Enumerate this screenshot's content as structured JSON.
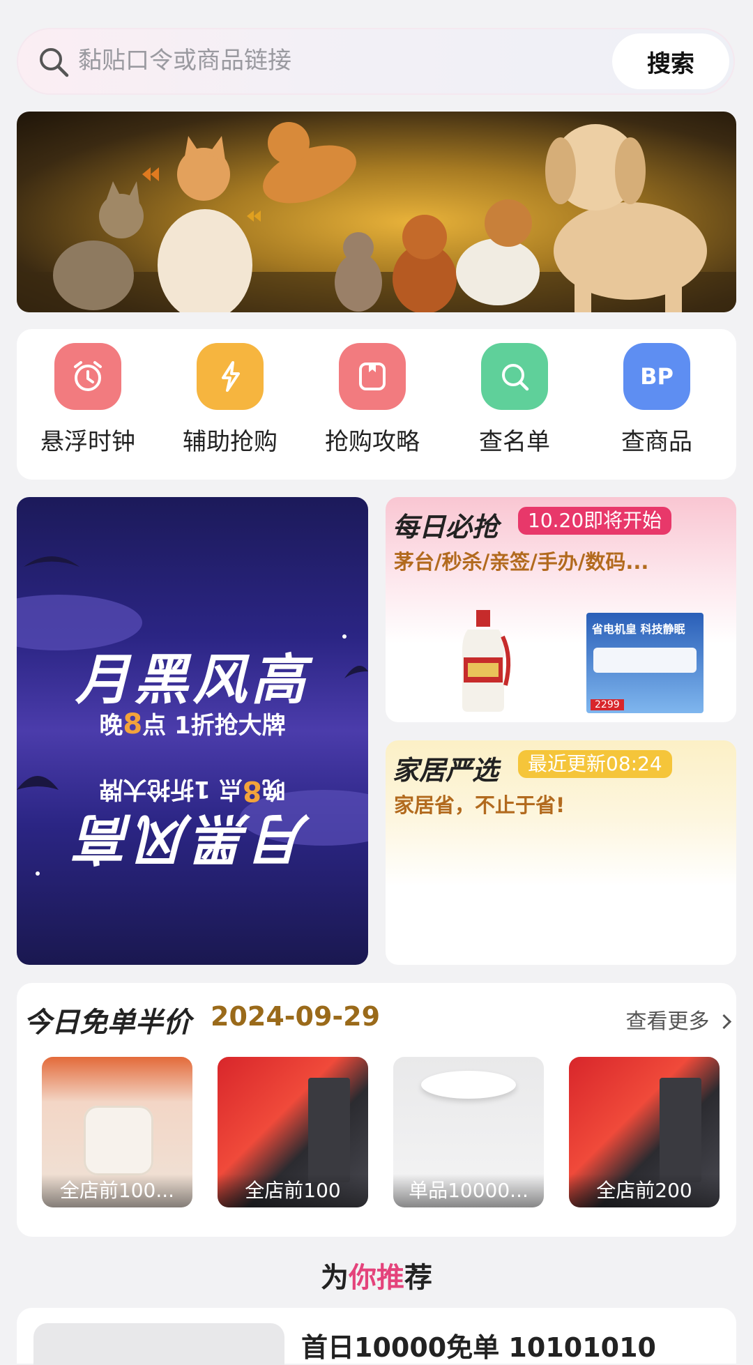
{
  "search": {
    "placeholder": "黏贴口令或商品链接",
    "button_label": "搜索"
  },
  "banner": {
    "description_icon": "pets-banner-image"
  },
  "quick_actions": [
    {
      "label": "悬浮时钟",
      "icon": "alarm-clock-icon",
      "color": "#f27b7f"
    },
    {
      "label": "辅助抢购",
      "icon": "lightning-icon",
      "color": "#f6b53f"
    },
    {
      "label": "抢购攻略",
      "icon": "bookmark-icon",
      "color": "#f27b7f"
    },
    {
      "label": "查名单",
      "icon": "search-icon",
      "color": "#5fd09a"
    },
    {
      "label": "查商品",
      "icon": "bp-icon",
      "icon_text": "BP",
      "color": "#5e8ef2"
    }
  ],
  "promo": {
    "title": "月黑风高",
    "subtitle_prefix": "晚",
    "subtitle_number": "8",
    "subtitle_suffix": "点 1折抢大牌"
  },
  "daily": {
    "title": "每日必抢",
    "tag": "10.20即将开始",
    "desc": "茅台/秒杀/亲签/手办/数码...",
    "tag_color": "#e8386a",
    "ac_headline": "省电机皇 科技静眠",
    "ac_price": "2299"
  },
  "home": {
    "title": "家居严选",
    "tag": "最近更新08:24",
    "desc": "家居省，不止于省!",
    "tag_color": "#f5c53a"
  },
  "free_half": {
    "title": "今日免单半价",
    "date": "2024-09-29",
    "more": "查看更多",
    "products": [
      {
        "label": "全店前100..."
      },
      {
        "label": "全店前100"
      },
      {
        "label": "单品10000..."
      },
      {
        "label": "全店前200"
      }
    ]
  },
  "recommend": {
    "title_a": "为",
    "title_b": "你推",
    "title_c": "荐",
    "first_item": "首日10000免单 10101010"
  }
}
